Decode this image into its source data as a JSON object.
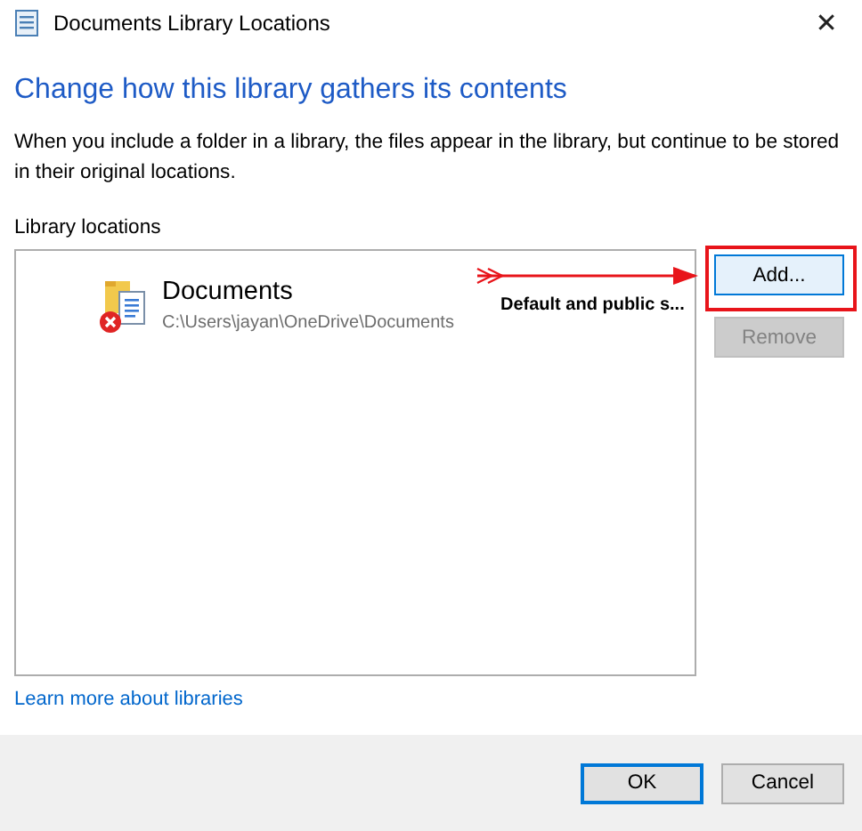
{
  "window": {
    "title": "Documents Library Locations",
    "close": "✕"
  },
  "heading": "Change how this library gathers its contents",
  "description": "When you include a folder in a library, the files appear in the library, but continue to be stored in their original locations.",
  "locations": {
    "label": "Library locations",
    "items": [
      {
        "name": "Documents",
        "path": "C:\\Users\\jayan\\OneDrive\\Documents",
        "status": "Default and public s...",
        "error": true
      }
    ]
  },
  "side_buttons": [
    {
      "label": "Add...",
      "disabled": false,
      "highlighted": true
    },
    {
      "label": "Remove",
      "disabled": true,
      "highlighted": false
    }
  ],
  "link": "Learn more about libraries",
  "footer_buttons": [
    {
      "label": "OK",
      "default": true
    },
    {
      "label": "Cancel",
      "default": false
    }
  ]
}
